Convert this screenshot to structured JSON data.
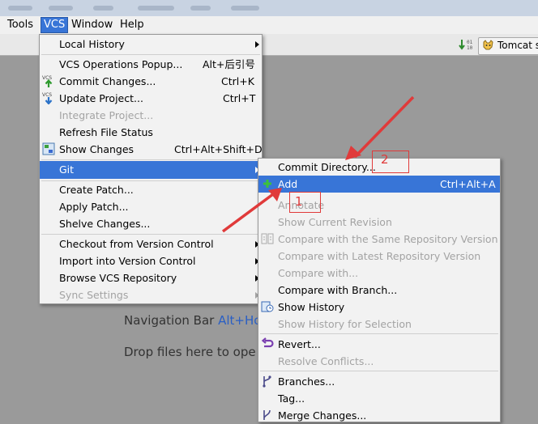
{
  "menubar": {
    "items": [
      "Tools",
      "VCS",
      "Window",
      "Help"
    ],
    "active": "VCS"
  },
  "toolbar": {
    "run_config": "Tomcat s"
  },
  "vcs_menu": {
    "items": [
      {
        "label": "Local History",
        "shortcut": "",
        "submenu": true
      },
      {
        "label": "VCS Operations Popup...",
        "shortcut": "Alt+后引号"
      },
      {
        "label": "Commit Changes...",
        "shortcut": "Ctrl+K",
        "icon": "vcs-commit-icon"
      },
      {
        "label": "Update Project...",
        "shortcut": "Ctrl+T",
        "icon": "vcs-update-icon"
      },
      {
        "label": "Integrate Project...",
        "shortcut": "",
        "disabled": true
      },
      {
        "label": "Refresh File Status",
        "shortcut": ""
      },
      {
        "label": "Show Changes",
        "shortcut": "Ctrl+Alt+Shift+D",
        "icon": "show-changes-icon"
      },
      {
        "label": "Git",
        "shortcut": "",
        "submenu": true,
        "highlighted": true
      },
      {
        "label": "Create Patch...",
        "shortcut": ""
      },
      {
        "label": "Apply Patch...",
        "shortcut": ""
      },
      {
        "label": "Shelve Changes...",
        "shortcut": ""
      },
      {
        "label": "Checkout from Version Control",
        "shortcut": "",
        "submenu": true
      },
      {
        "label": "Import into Version Control",
        "shortcut": "",
        "submenu": true
      },
      {
        "label": "Browse VCS Repository",
        "shortcut": "",
        "submenu": true
      },
      {
        "label": "Sync Settings",
        "shortcut": "",
        "submenu": true,
        "disabled": true
      }
    ]
  },
  "git_menu": {
    "items": [
      {
        "label": "Commit Directory...",
        "shortcut": ""
      },
      {
        "label": "Add",
        "shortcut": "Ctrl+Alt+A",
        "highlighted": true,
        "icon": "add-plus-icon"
      },
      {
        "label": "Annotate",
        "disabled": true
      },
      {
        "label": "Show Current Revision",
        "disabled": true
      },
      {
        "label": "Compare with the Same Repository Version",
        "disabled": true,
        "icon": "compare-icon"
      },
      {
        "label": "Compare with Latest Repository Version",
        "disabled": true
      },
      {
        "label": "Compare with...",
        "disabled": true
      },
      {
        "label": "Compare with Branch..."
      },
      {
        "label": "Show History",
        "icon": "history-icon"
      },
      {
        "label": "Show History for Selection",
        "disabled": true
      },
      {
        "label": "Revert...",
        "icon": "revert-icon"
      },
      {
        "label": "Resolve Conflicts...",
        "disabled": true
      },
      {
        "label": "Branches...",
        "icon": "branches-icon"
      },
      {
        "label": "Tag..."
      },
      {
        "label": "Merge Changes...",
        "icon": "merge-icon"
      }
    ]
  },
  "editor": {
    "nav_bar_text": "Navigation Bar",
    "nav_bar_shortcut": "Alt+Ho",
    "drop_files_text": "Drop files here to ope"
  },
  "annotations": {
    "one": "1",
    "two": "2"
  },
  "colors": {
    "highlight": "#3875d7",
    "annotation_red": "#e03a3a"
  }
}
